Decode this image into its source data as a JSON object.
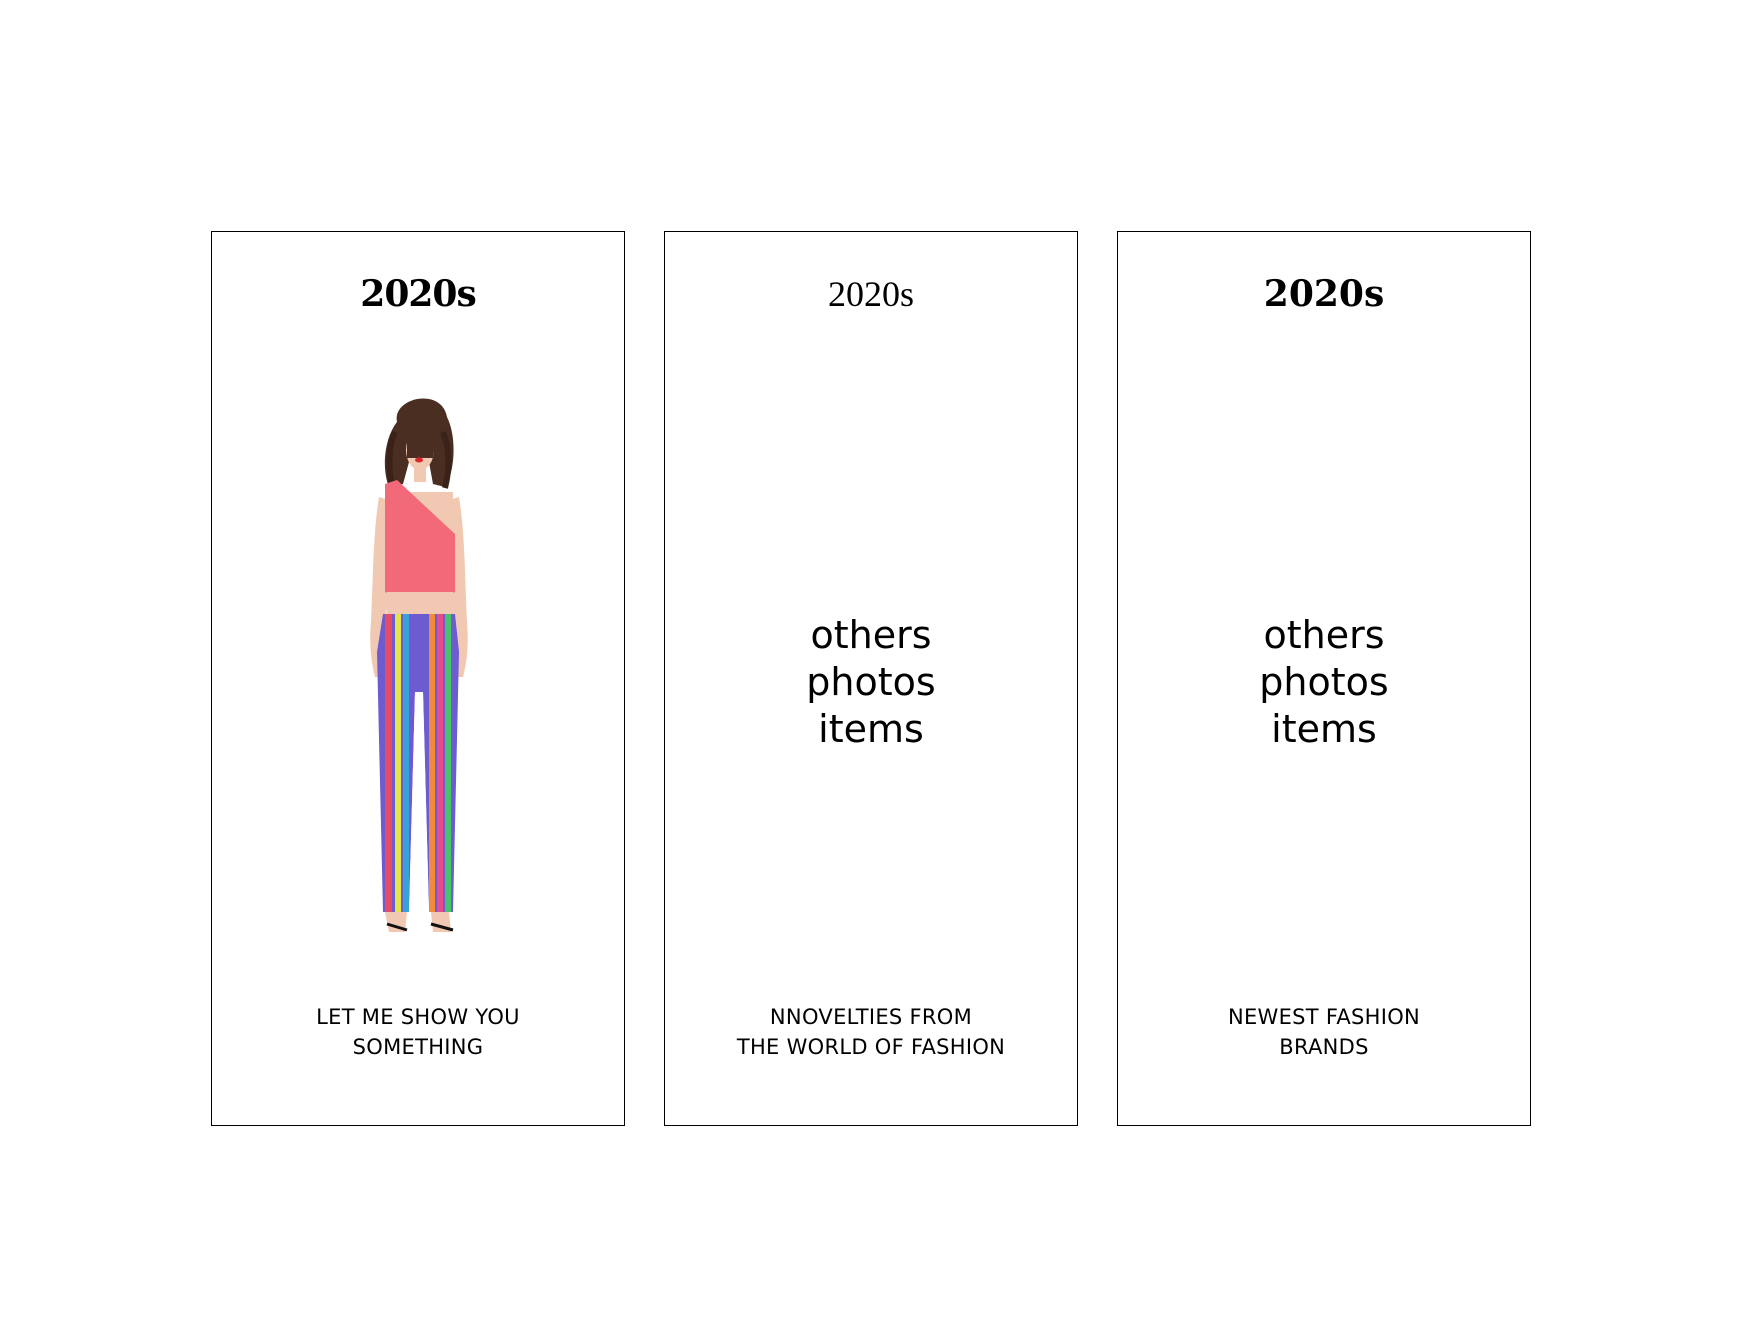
{
  "cards": [
    {
      "title": "2020s",
      "caption_line1": "LET ME SHOW YOU",
      "caption_line2": "SOMETHING",
      "image": "fashion-model-photo"
    },
    {
      "title": "2020s",
      "placeholder_lines": [
        "others",
        "photos",
        "items"
      ],
      "caption_line1": "NNOVELTIES FROM",
      "caption_line2": "THE WORLD OF FASHION"
    },
    {
      "title": "2020s",
      "placeholder_lines": [
        "others",
        "photos",
        "items"
      ],
      "caption_line1": "NEWEST FASHION",
      "caption_line2": "BRANDS"
    }
  ],
  "colors": {
    "background": "#ffffff",
    "border": "#000000",
    "text": "#000000",
    "top": "#f26a7a",
    "skin": "#f1c9b2",
    "hair": "#4a2e22"
  }
}
